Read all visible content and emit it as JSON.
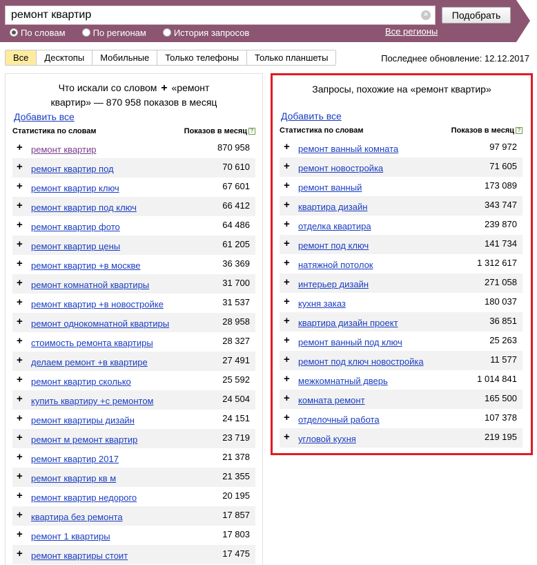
{
  "search": {
    "query": "ремонт квартир",
    "submit_label": "Подобрать",
    "modes": [
      {
        "label": "По словам",
        "selected": true
      },
      {
        "label": "По регионам",
        "selected": false
      },
      {
        "label": "История запросов",
        "selected": false
      }
    ],
    "regions_link": "Все регионы"
  },
  "tabs": [
    {
      "label": "Все",
      "active": true
    },
    {
      "label": "Десктопы",
      "active": false
    },
    {
      "label": "Мобильные",
      "active": false
    },
    {
      "label": "Только телефоны",
      "active": false
    },
    {
      "label": "Только планшеты",
      "active": false
    }
  ],
  "last_update": "Последнее обновление: 12.12.2017",
  "colors": {
    "banner": "#8c5672",
    "link": "#1a3dc1",
    "highlight_border": "#e01a22",
    "active_tab": "#ffeba0"
  },
  "left_panel": {
    "title_line1_prefix": "Что искали со словом",
    "title_line1_suffix": "«ремонт",
    "title_line2": "квартир» — 870 958 показов в месяц",
    "add_all": "Добавить все",
    "col_words": "Статистика по словам",
    "col_shows": "Показов в месяц",
    "rows": [
      {
        "keyword": "ремонт квартир",
        "count": "870 958"
      },
      {
        "keyword": "ремонт квартир под",
        "count": "70 610"
      },
      {
        "keyword": "ремонт квартир ключ",
        "count": "67 601"
      },
      {
        "keyword": "ремонт квартир под ключ",
        "count": "66 412"
      },
      {
        "keyword": "ремонт квартир фото",
        "count": "64 486"
      },
      {
        "keyword": "ремонт квартир цены",
        "count": "61 205"
      },
      {
        "keyword": "ремонт квартир +в москве",
        "count": "36 369"
      },
      {
        "keyword": "ремонт комнатной квартиры",
        "count": "31 700"
      },
      {
        "keyword": "ремонт квартир +в новостройке",
        "count": "31 537"
      },
      {
        "keyword": "ремонт однокомнатной квартиры",
        "count": "28 958"
      },
      {
        "keyword": "стоимость ремонта квартиры",
        "count": "28 327"
      },
      {
        "keyword": "делаем ремонт +в квартире",
        "count": "27 491"
      },
      {
        "keyword": "ремонт квартир сколько",
        "count": "25 592"
      },
      {
        "keyword": "купить квартиру +с ремонтом",
        "count": "24 504"
      },
      {
        "keyword": "ремонт квартиры дизайн",
        "count": "24 151"
      },
      {
        "keyword": "ремонт м ремонт квартир",
        "count": "23 719"
      },
      {
        "keyword": "ремонт квартир 2017",
        "count": "21 378"
      },
      {
        "keyword": "ремонт квартир кв м",
        "count": "21 355"
      },
      {
        "keyword": "ремонт квартир недорого",
        "count": "20 195"
      },
      {
        "keyword": "квартира без ремонта",
        "count": "17 857"
      },
      {
        "keyword": "ремонт 1 квартиры",
        "count": "17 803"
      },
      {
        "keyword": "ремонт квартиры стоит",
        "count": "17 475"
      }
    ]
  },
  "right_panel": {
    "title": "Запросы, похожие на «ремонт квартир»",
    "add_all": "Добавить все",
    "col_words": "Статистика по словам",
    "col_shows": "Показов в месяц",
    "rows": [
      {
        "keyword": "ремонт ванный комната",
        "count": "97 972"
      },
      {
        "keyword": "ремонт новостройка",
        "count": "71 605"
      },
      {
        "keyword": "ремонт ванный",
        "count": "173 089"
      },
      {
        "keyword": "квартира дизайн",
        "count": "343 747"
      },
      {
        "keyword": "отделка квартира",
        "count": "239 870"
      },
      {
        "keyword": "ремонт под ключ",
        "count": "141 734"
      },
      {
        "keyword": "натяжной потолок",
        "count": "1 312 617"
      },
      {
        "keyword": "интерьер дизайн",
        "count": "271 058"
      },
      {
        "keyword": "кухня заказ",
        "count": "180 037"
      },
      {
        "keyword": "квартира дизайн проект",
        "count": "36 851"
      },
      {
        "keyword": "ремонт ванный под ключ",
        "count": "25 263"
      },
      {
        "keyword": "ремонт под ключ новостройка",
        "count": "11 577"
      },
      {
        "keyword": "межкомнатный дверь",
        "count": "1 014 841"
      },
      {
        "keyword": "комната ремонт",
        "count": "165 500"
      },
      {
        "keyword": "отделочный работа",
        "count": "107 378"
      },
      {
        "keyword": "угловой кухня",
        "count": "219 195"
      }
    ]
  }
}
